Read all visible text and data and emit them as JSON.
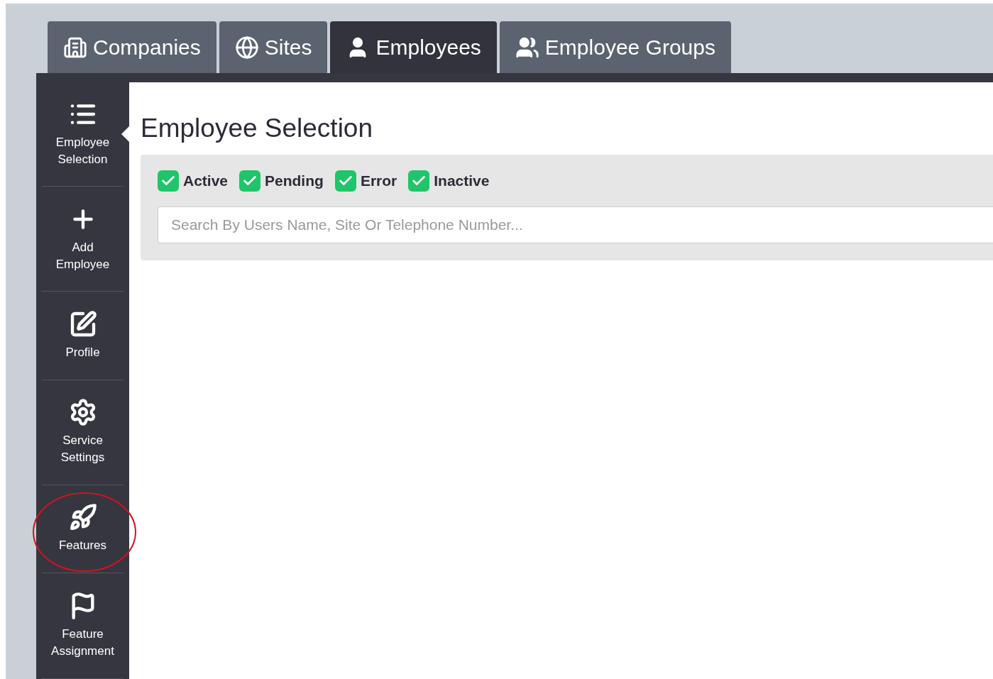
{
  "tabs": [
    {
      "label": "Companies",
      "selected": false
    },
    {
      "label": "Sites",
      "selected": false
    },
    {
      "label": "Employees",
      "selected": true
    },
    {
      "label": "Employee Groups",
      "selected": false
    }
  ],
  "sidebar": {
    "items": [
      {
        "label": "Employee Selection",
        "selected": true,
        "circled": false
      },
      {
        "label": "Add Employee",
        "selected": false,
        "circled": false
      },
      {
        "label": "Profile",
        "selected": false,
        "circled": false
      },
      {
        "label": "Service Settings",
        "selected": false,
        "circled": false
      },
      {
        "label": "Features",
        "selected": false,
        "circled": true
      },
      {
        "label": "Feature Assignment",
        "selected": false,
        "circled": false
      }
    ]
  },
  "content": {
    "title": "Employee Selection",
    "filters": [
      {
        "label": "Active",
        "checked": true
      },
      {
        "label": "Pending",
        "checked": true
      },
      {
        "label": "Error",
        "checked": true
      },
      {
        "label": "Inactive",
        "checked": true
      }
    ],
    "search": {
      "placeholder": "Search By Users Name, Site Or Telephone Number..."
    }
  }
}
